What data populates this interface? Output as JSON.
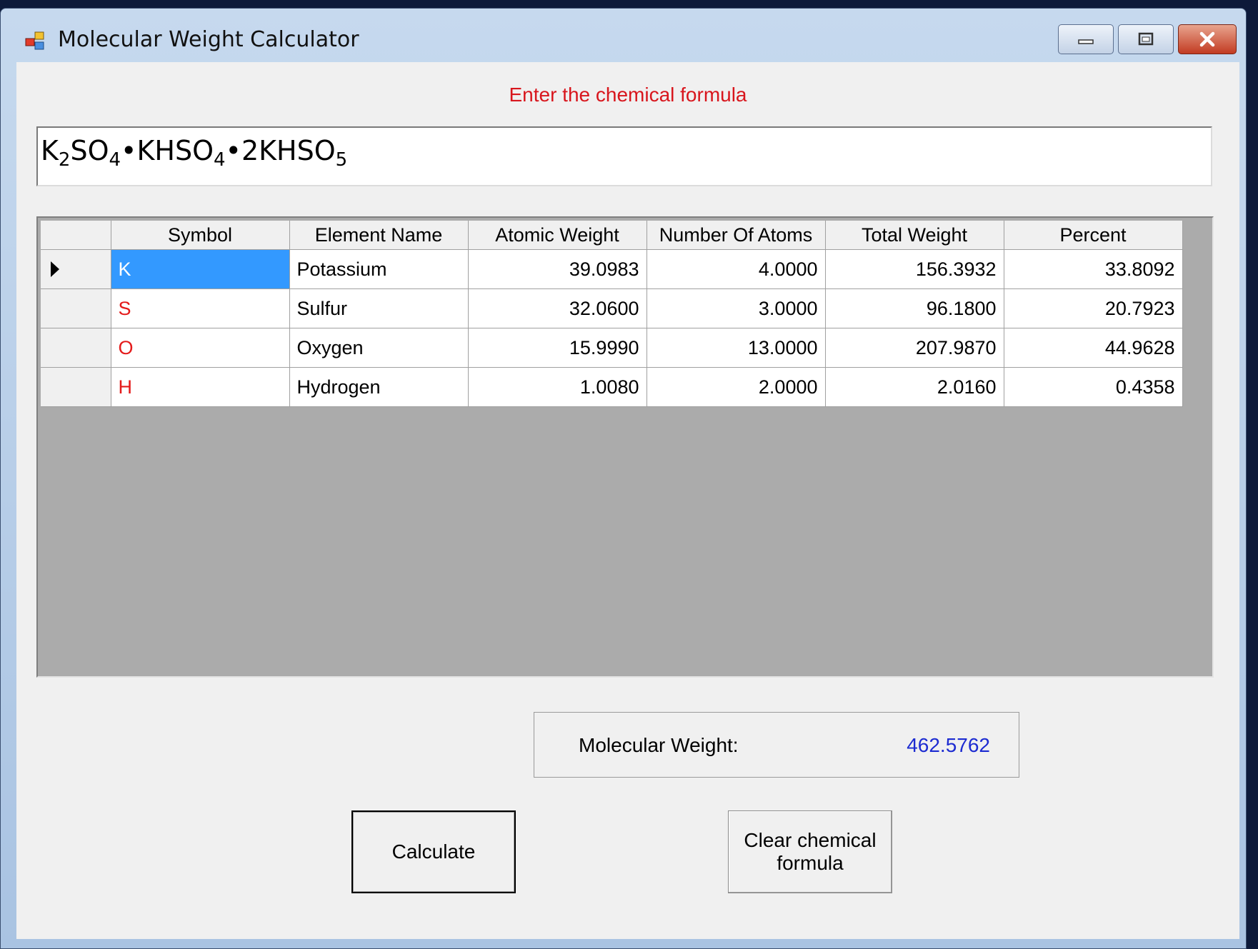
{
  "window": {
    "title": "Molecular Weight Calculator"
  },
  "prompt": "Enter the chemical formula",
  "formula": [
    {
      "text": "K",
      "sub": "2"
    },
    {
      "text": "SO",
      "sub": "4"
    },
    {
      "text": "•KHSO",
      "sub": "4"
    },
    {
      "text": "•2KHSO",
      "sub": "5"
    }
  ],
  "table": {
    "headers": [
      "Symbol",
      "Element Name",
      "Atomic Weight",
      "Number Of Atoms",
      "Total Weight",
      "Percent"
    ],
    "rows": [
      {
        "symbol": "K",
        "name": "Potassium",
        "atomic_weight": "39.0983",
        "atoms": "4.0000",
        "total_weight": "156.3932",
        "percent": "33.8092"
      },
      {
        "symbol": "S",
        "name": "Sulfur",
        "atomic_weight": "32.0600",
        "atoms": "3.0000",
        "total_weight": "96.1800",
        "percent": "20.7923"
      },
      {
        "symbol": "O",
        "name": "Oxygen",
        "atomic_weight": "15.9990",
        "atoms": "13.0000",
        "total_weight": "207.9870",
        "percent": "44.9628"
      },
      {
        "symbol": "H",
        "name": "Hydrogen",
        "atomic_weight": "1.0080",
        "atoms": "2.0000",
        "total_weight": "2.0160",
        "percent": "0.4358"
      }
    ]
  },
  "result": {
    "label": "Molecular Weight:",
    "value": "462.5762"
  },
  "buttons": {
    "calculate": "Calculate",
    "clear": "Clear chemical formula"
  },
  "icons": {
    "app": "app-icon",
    "minimize": "minimize-icon",
    "maximize": "maximize-icon",
    "close": "close-icon",
    "row_selector": "current-row-arrow-icon"
  },
  "colors": {
    "prompt_text": "#d8161d",
    "symbol_text": "#e41b1b",
    "selection": "#3399ff",
    "result_value": "#1c2bd1"
  }
}
